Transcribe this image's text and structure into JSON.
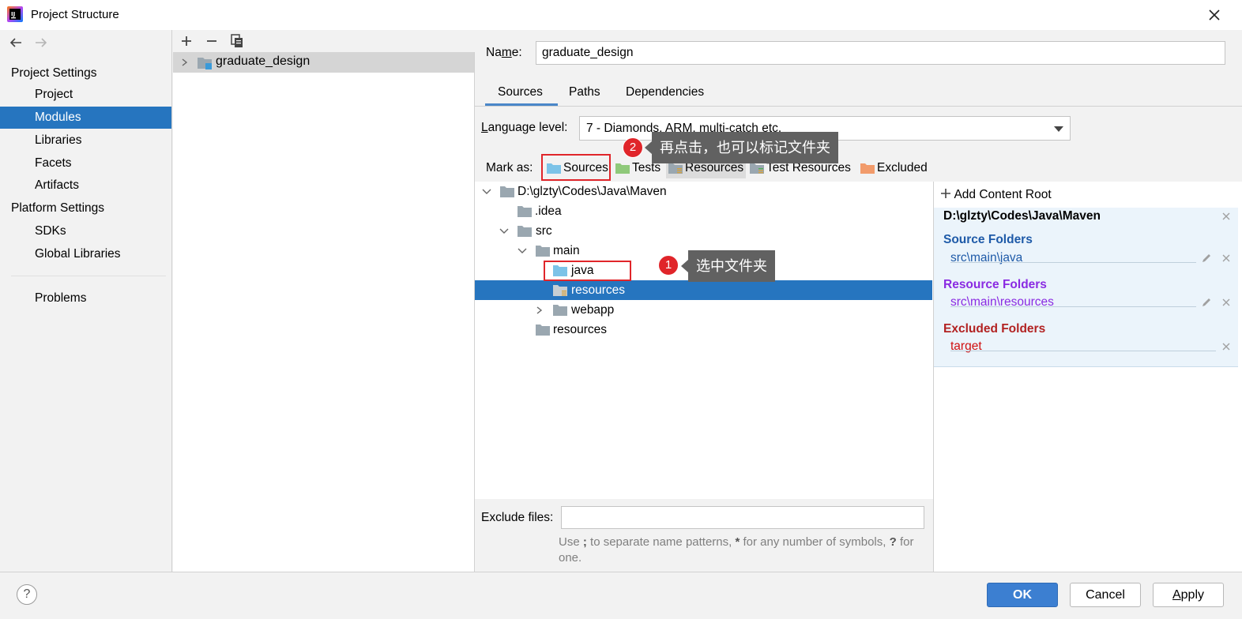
{
  "window": {
    "title": "Project Structure"
  },
  "sidebar": {
    "project_settings_header": "Project Settings",
    "project_items": [
      {
        "label": "Project"
      },
      {
        "label": "Modules"
      },
      {
        "label": "Libraries"
      },
      {
        "label": "Facets"
      },
      {
        "label": "Artifacts"
      }
    ],
    "platform_settings_header": "Platform Settings",
    "platform_items": [
      {
        "label": "SDKs"
      },
      {
        "label": "Global Libraries"
      }
    ],
    "problems_label": "Problems",
    "selected": "Modules"
  },
  "modules": {
    "items": [
      {
        "label": "graduate_design"
      }
    ]
  },
  "module_settings": {
    "name_label": "Name:",
    "name_value": "graduate_design",
    "tabs": [
      {
        "label": "Sources"
      },
      {
        "label": "Paths"
      },
      {
        "label": "Dependencies"
      }
    ],
    "active_tab": "Sources",
    "language_level_label": "Language level:",
    "language_level_value": "7 - Diamonds, ARM, multi-catch etc.",
    "mark_as_label": "Mark as:",
    "mark_as_buttons": [
      {
        "label": "Sources"
      },
      {
        "label": "Tests"
      },
      {
        "label": "Resources"
      },
      {
        "label": "Test Resources"
      },
      {
        "label": "Excluded"
      }
    ]
  },
  "tree": {
    "rows": [
      {
        "label": "D:\\glzty\\Codes\\Java\\Maven"
      },
      {
        "label": ".idea"
      },
      {
        "label": "src"
      },
      {
        "label": "main"
      },
      {
        "label": "java"
      },
      {
        "label": "resources"
      },
      {
        "label": "webapp"
      },
      {
        "label": "resources"
      }
    ],
    "selected_row": "resources"
  },
  "exclude": {
    "label": "Exclude files:",
    "value": "",
    "help_prefix": "Use",
    "help_sep": ";",
    "help_mid": "to separate name patterns,",
    "help_star": "*",
    "help_mid2": "for any number of symbols,",
    "help_q": "?",
    "help_end": "for one."
  },
  "content_roots": {
    "add_label": "Add Content Root",
    "root_path": "D:\\glzty\\Codes\\Java\\Maven",
    "source_folders_title": "Source Folders",
    "source_folders": [
      "src\\main\\java"
    ],
    "resource_folders_title": "Resource Folders",
    "resource_folders": [
      "src\\main\\resources"
    ],
    "excluded_folders_title": "Excluded Folders",
    "excluded_folders": [
      "target"
    ]
  },
  "annotations": {
    "step1_number": "1",
    "step1_text": "选中文件夹",
    "step2_number": "2",
    "step2_text": "再点击，也可以标记文件夹"
  },
  "buttons": {
    "help": "?",
    "ok": "OK",
    "cancel": "Cancel",
    "apply": "Apply"
  },
  "colors": {
    "selection": "#2675bf",
    "source_title": "#1e5aa8",
    "resource_title": "#8a2be2",
    "excluded_title": "#b22222",
    "annotation_red": "#e0252a",
    "callout_bg": "#616161"
  }
}
